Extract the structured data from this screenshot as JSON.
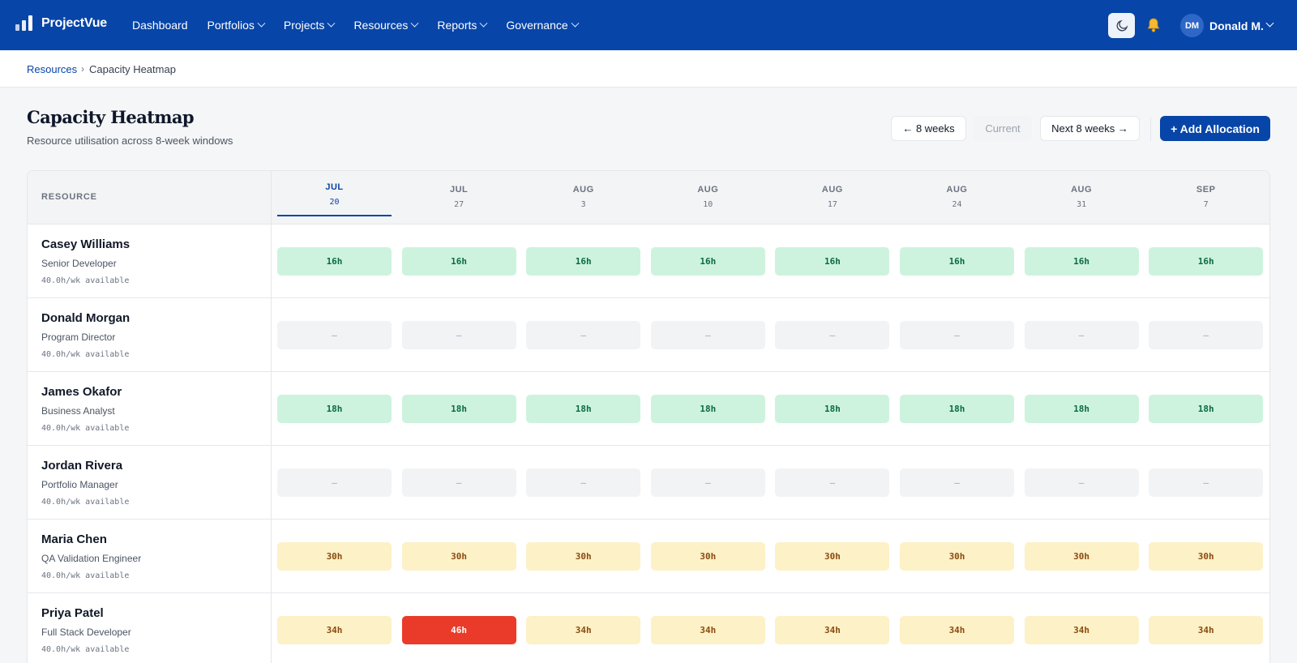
{
  "app": {
    "name": "ProjectVue"
  },
  "nav": [
    {
      "label": "Dashboard",
      "has_menu": false
    },
    {
      "label": "Portfolios",
      "has_menu": true
    },
    {
      "label": "Projects",
      "has_menu": true
    },
    {
      "label": "Resources",
      "has_menu": true
    },
    {
      "label": "Reports",
      "has_menu": true
    },
    {
      "label": "Governance",
      "has_menu": true
    }
  ],
  "user": {
    "initials": "DM",
    "name": "Donald M."
  },
  "icons": {
    "theme": "moon-icon",
    "notifications": "bell-icon",
    "logo": "bar-chart-logo-icon"
  },
  "breadcrumb": {
    "parent": "Resources",
    "separator": "›",
    "current": "Capacity Heatmap"
  },
  "page": {
    "title": "Capacity Heatmap",
    "subtitle": "Resource utilisation across 8-week windows"
  },
  "actions": {
    "prev": "← 8 weeks",
    "current": "Current",
    "next": "Next 8 weeks →",
    "add": "+ Add Allocation"
  },
  "heatmap": {
    "resource_header": "RESOURCE",
    "weeks": [
      {
        "month": "JUL",
        "day": "20",
        "current": true
      },
      {
        "month": "JUL",
        "day": "27",
        "current": false
      },
      {
        "month": "AUG",
        "day": "3",
        "current": false
      },
      {
        "month": "AUG",
        "day": "10",
        "current": false
      },
      {
        "month": "AUG",
        "day": "17",
        "current": false
      },
      {
        "month": "AUG",
        "day": "24",
        "current": false
      },
      {
        "month": "AUG",
        "day": "31",
        "current": false
      },
      {
        "month": "SEP",
        "day": "7",
        "current": false
      }
    ],
    "rows": [
      {
        "name": "Casey Williams",
        "role": "Senior Developer",
        "availability": "40.0h/wk available",
        "cells": [
          {
            "label": "16h",
            "level": "green"
          },
          {
            "label": "16h",
            "level": "green"
          },
          {
            "label": "16h",
            "level": "green"
          },
          {
            "label": "16h",
            "level": "green"
          },
          {
            "label": "16h",
            "level": "green"
          },
          {
            "label": "16h",
            "level": "green"
          },
          {
            "label": "16h",
            "level": "green"
          },
          {
            "label": "16h",
            "level": "green"
          }
        ]
      },
      {
        "name": "Donald Morgan",
        "role": "Program Director",
        "availability": "40.0h/wk available",
        "cells": [
          {
            "label": "–",
            "level": "empty"
          },
          {
            "label": "–",
            "level": "empty"
          },
          {
            "label": "–",
            "level": "empty"
          },
          {
            "label": "–",
            "level": "empty"
          },
          {
            "label": "–",
            "level": "empty"
          },
          {
            "label": "–",
            "level": "empty"
          },
          {
            "label": "–",
            "level": "empty"
          },
          {
            "label": "–",
            "level": "empty"
          }
        ]
      },
      {
        "name": "James Okafor",
        "role": "Business Analyst",
        "availability": "40.0h/wk available",
        "cells": [
          {
            "label": "18h",
            "level": "green"
          },
          {
            "label": "18h",
            "level": "green"
          },
          {
            "label": "18h",
            "level": "green"
          },
          {
            "label": "18h",
            "level": "green"
          },
          {
            "label": "18h",
            "level": "green"
          },
          {
            "label": "18h",
            "level": "green"
          },
          {
            "label": "18h",
            "level": "green"
          },
          {
            "label": "18h",
            "level": "green"
          }
        ]
      },
      {
        "name": "Jordan Rivera",
        "role": "Portfolio Manager",
        "availability": "40.0h/wk available",
        "cells": [
          {
            "label": "–",
            "level": "empty"
          },
          {
            "label": "–",
            "level": "empty"
          },
          {
            "label": "–",
            "level": "empty"
          },
          {
            "label": "–",
            "level": "empty"
          },
          {
            "label": "–",
            "level": "empty"
          },
          {
            "label": "–",
            "level": "empty"
          },
          {
            "label": "–",
            "level": "empty"
          },
          {
            "label": "–",
            "level": "empty"
          }
        ]
      },
      {
        "name": "Maria Chen",
        "role": "QA Validation Engineer",
        "availability": "40.0h/wk available",
        "cells": [
          {
            "label": "30h",
            "level": "amber"
          },
          {
            "label": "30h",
            "level": "amber"
          },
          {
            "label": "30h",
            "level": "amber"
          },
          {
            "label": "30h",
            "level": "amber"
          },
          {
            "label": "30h",
            "level": "amber"
          },
          {
            "label": "30h",
            "level": "amber"
          },
          {
            "label": "30h",
            "level": "amber"
          },
          {
            "label": "30h",
            "level": "amber"
          }
        ]
      },
      {
        "name": "Priya Patel",
        "role": "Full Stack Developer",
        "availability": "40.0h/wk available",
        "cells": [
          {
            "label": "34h",
            "level": "amber"
          },
          {
            "label": "46h",
            "level": "red"
          },
          {
            "label": "34h",
            "level": "amber"
          },
          {
            "label": "34h",
            "level": "amber"
          },
          {
            "label": "34h",
            "level": "amber"
          },
          {
            "label": "34h",
            "level": "amber"
          },
          {
            "label": "34h",
            "level": "amber"
          },
          {
            "label": "34h",
            "level": "amber"
          }
        ]
      }
    ]
  },
  "colors": {
    "brand": "#0745a8",
    "level_green": "#cdf3de",
    "level_amber": "#fdf1c7",
    "level_red": "#ea3b2a",
    "level_empty": "#f1f3f5"
  }
}
